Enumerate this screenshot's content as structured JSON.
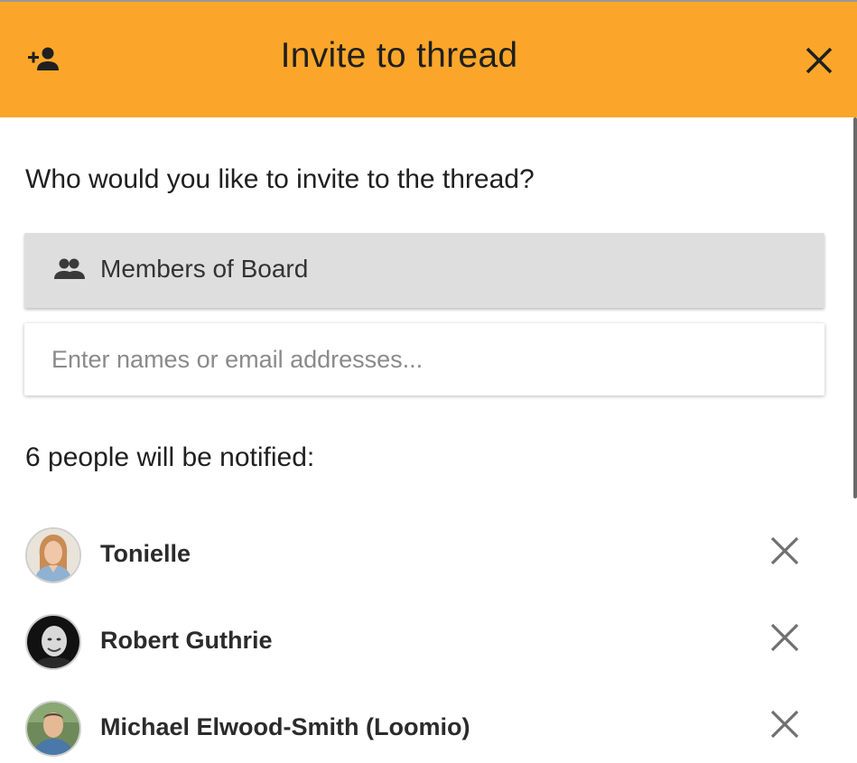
{
  "dialog": {
    "title": "Invite to thread",
    "header_color": "#FBA62A",
    "add_icon": "person-add-icon",
    "close_icon": "close-icon"
  },
  "form": {
    "question": "Who would you like to invite to the thread?",
    "members_label": "Members of Board",
    "members_icon": "group-icon",
    "input_placeholder": "Enter names or email addresses...",
    "input_value": ""
  },
  "recipients": {
    "heading": "6 people will be notified:",
    "remove_icon": "close-icon",
    "people": [
      {
        "name": "Tonielle"
      },
      {
        "name": "Robert Guthrie"
      },
      {
        "name": "Michael Elwood-Smith (Loomio)"
      }
    ]
  }
}
